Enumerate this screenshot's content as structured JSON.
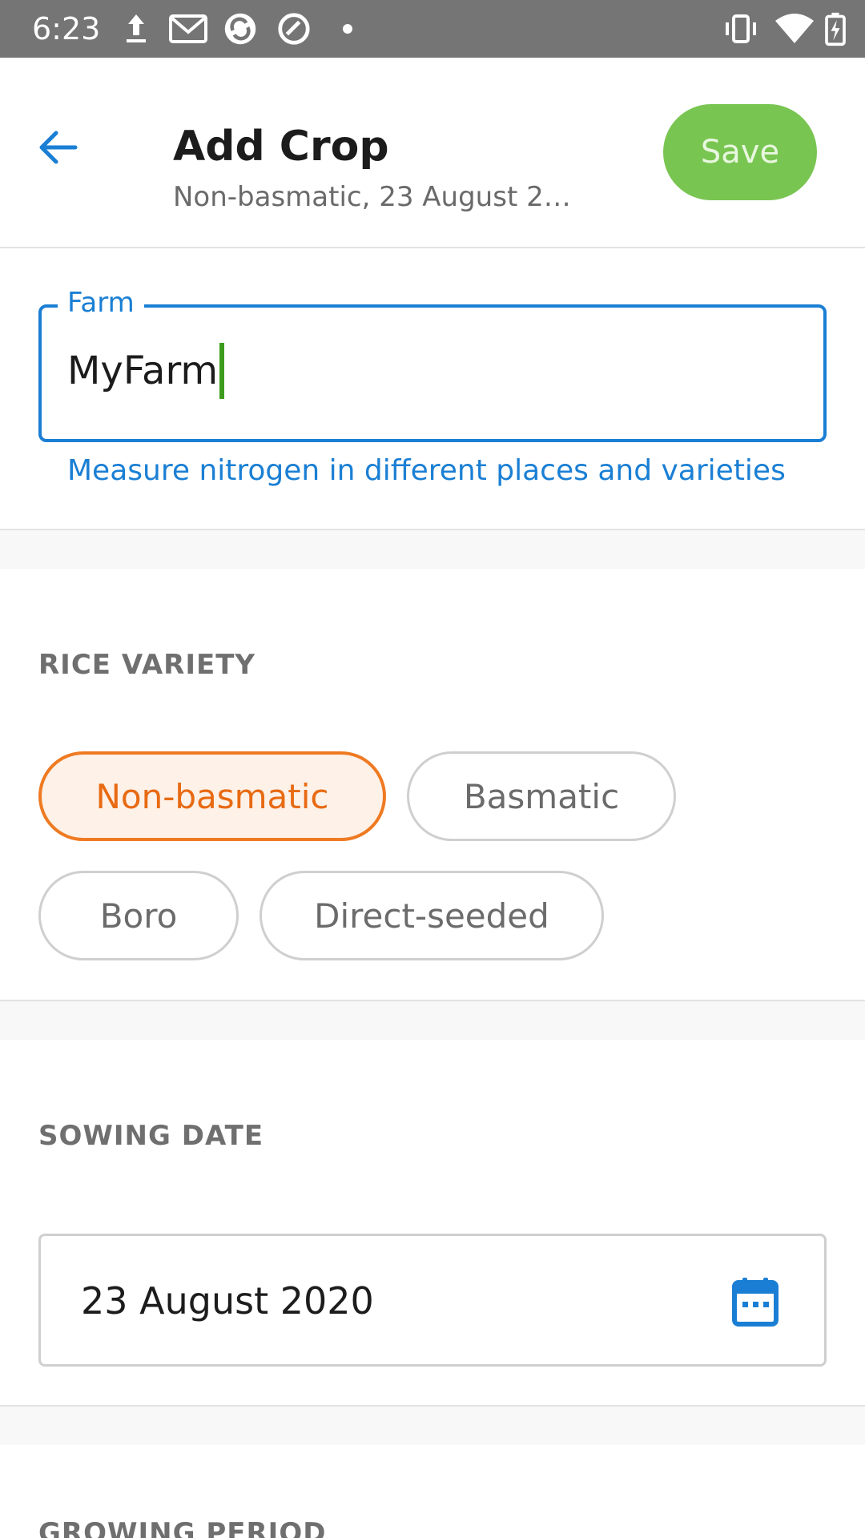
{
  "status_bar": {
    "time": "6:23",
    "icons": [
      "upload-icon",
      "gmail-icon",
      "sync-app-icon",
      "app-icon",
      "dot-icon",
      "vibrate-icon",
      "wifi-icon",
      "battery-charging-icon"
    ]
  },
  "header": {
    "title": "Add Crop",
    "subtitle": "Non-basmatic, 23 August 2…",
    "save_label": "Save",
    "back_icon": "arrow-back-icon"
  },
  "farm": {
    "label": "Farm",
    "value": "MyFarm",
    "helper": "Measure nitrogen in different places and varieties"
  },
  "rice_variety": {
    "heading": "RICE VARIETY",
    "options": [
      {
        "label": "Non-basmatic",
        "selected": true
      },
      {
        "label": "Basmatic",
        "selected": false
      },
      {
        "label": "Boro",
        "selected": false
      },
      {
        "label": "Direct-seeded",
        "selected": false
      }
    ]
  },
  "sowing_date": {
    "heading": "SOWING DATE",
    "value": "23 August 2020",
    "icon": "calendar-icon"
  },
  "growing_period": {
    "heading": "GROWING PERIOD"
  },
  "colors": {
    "primary_blue": "#1a7fd4",
    "save_green": "#79c552",
    "selected_orange": "#ef7a22",
    "status_bar": "#757575"
  }
}
